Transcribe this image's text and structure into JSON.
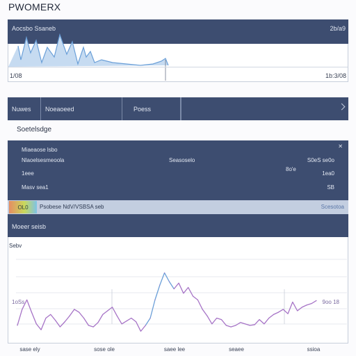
{
  "app": {
    "title": "PWOMERX"
  },
  "overview": {
    "header_left": "Aocsbo Ssaneb",
    "header_right": "2b/a9",
    "footer_left": "1/08",
    "footer_right": "1b:3/08"
  },
  "tabs": [
    {
      "label": "Nuwes"
    },
    {
      "label": "Noeaoeed"
    },
    {
      "label": "Poess"
    }
  ],
  "section": {
    "title": "Soetelsdge"
  },
  "details": {
    "corner_icon": "close-icon",
    "row1": "Miaeaose lsbo",
    "row2_left": "Nlaoelsesmeoola",
    "row2_mid": "Seasoselo",
    "row2_right": "S0eS se0o",
    "row3_left": "1eee",
    "row3_sub": "8o'e",
    "row3_right": "1ea0",
    "row4_left": "Masv sea1",
    "row4_right": "SB"
  },
  "status_bar": {
    "badge": "OL0",
    "text": "Psobese NdV/VSBSA seb",
    "right": "Scesotoa"
  },
  "chart_panel": {
    "header": "Moeer seisb",
    "label": "Sebv"
  },
  "chart_data": {
    "type": "line",
    "title": "",
    "xlabel": "",
    "ylabel": "",
    "x_tick_labels": [
      "sase ely",
      "sose ole",
      "saee lee",
      "seaee",
      "ssioa"
    ],
    "y_tick_labels": [
      "1oSs",
      "9oo 18"
    ],
    "series": [
      {
        "values": [
          20,
          42,
          55,
          38,
          22,
          14,
          30,
          35,
          27,
          18,
          25,
          33,
          42,
          38,
          30,
          20,
          18,
          24,
          35,
          40,
          45,
          33,
          22,
          26,
          30,
          25,
          12,
          20,
          30,
          55,
          75,
          92,
          80,
          70,
          78,
          64,
          72,
          60,
          55,
          42,
          33,
          22,
          30,
          28,
          20,
          18,
          20,
          24,
          22,
          20,
          21,
          28,
          22,
          30,
          35,
          38,
          42,
          36,
          52,
          40,
          45,
          48,
          50,
          54
        ]
      }
    ],
    "ylim": [
      0,
      100
    ],
    "grid": true
  },
  "colors": {
    "navy": "#3d4d70",
    "line_purple": "#a673c6",
    "line_blue": "#6a9fd8"
  }
}
